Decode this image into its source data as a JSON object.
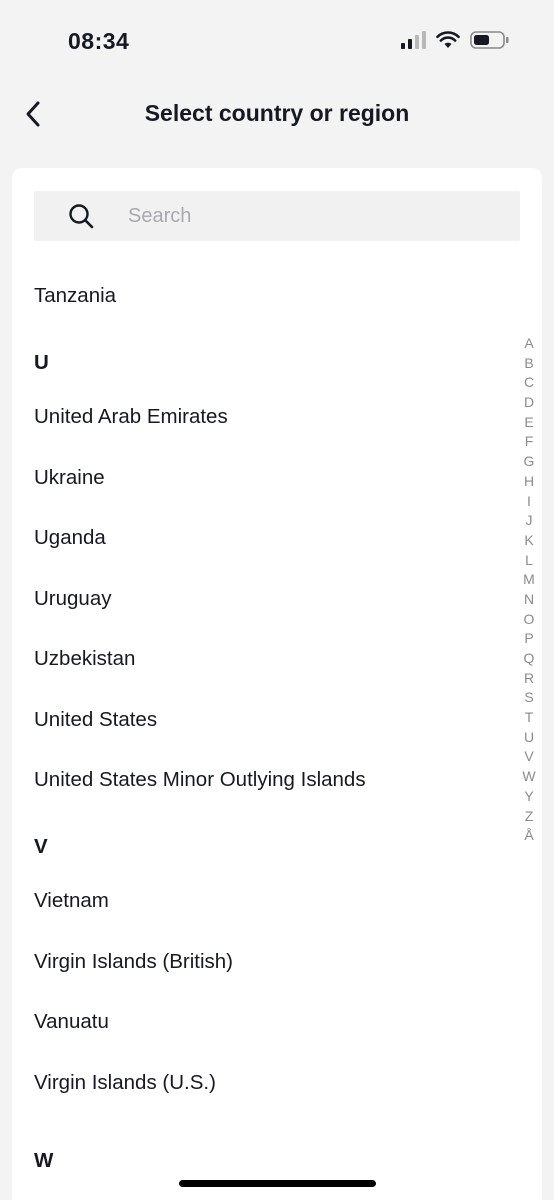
{
  "status_bar": {
    "time": "08:34"
  },
  "header": {
    "title": "Select country or region"
  },
  "search": {
    "placeholder": "Search",
    "value": ""
  },
  "list": {
    "row_top": "Tanzania",
    "section_u": "U",
    "u_items": [
      "United Arab Emirates",
      "Ukraine",
      "Uganda",
      "Uruguay",
      "Uzbekistan",
      "United States",
      "United States Minor Outlying Islands"
    ],
    "section_v": "V",
    "v_items": [
      "Vietnam",
      "Virgin Islands (British)",
      "Vanuatu",
      "Virgin Islands (U.S.)"
    ],
    "section_w": "W"
  },
  "alpha_index": [
    "A",
    "B",
    "C",
    "D",
    "E",
    "F",
    "G",
    "H",
    "I",
    "J",
    "K",
    "L",
    "M",
    "N",
    "O",
    "P",
    "Q",
    "R",
    "S",
    "T",
    "U",
    "V",
    "W",
    "Y",
    "Z",
    "Å"
  ]
}
